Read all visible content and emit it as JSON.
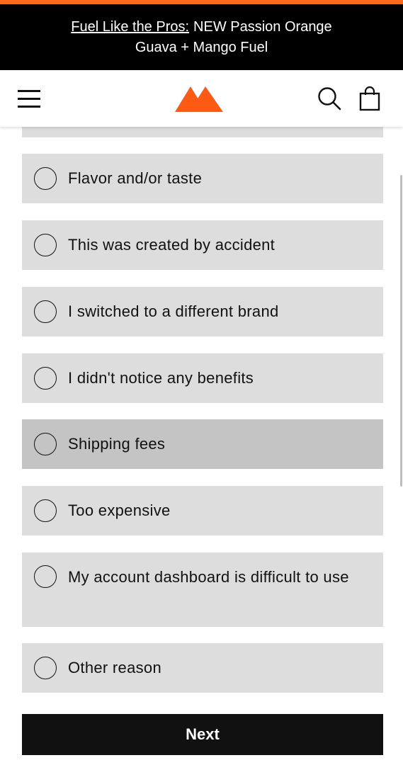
{
  "colors": {
    "accent": "#ff6b1a",
    "option_bg": "#dddddd",
    "option_hover_bg": "#c4c4c4",
    "button_bg": "#111111"
  },
  "announcement": {
    "link_text": "Fuel Like the Pros:",
    "line1_rest": "NEW Passion Orange",
    "line2": "Guava + Mango Fuel"
  },
  "header": {
    "menu_icon": "hamburger-icon",
    "logo_icon": "brand-m-logo",
    "search_icon": "search-icon",
    "cart_icon": "shopping-bag-icon"
  },
  "survey": {
    "options": [
      {
        "label": "Flavor and/or taste"
      },
      {
        "label": "This was created by accident"
      },
      {
        "label": "I switched to a different brand"
      },
      {
        "label": "I didn't notice any benefits"
      },
      {
        "label": "Shipping fees"
      },
      {
        "label": "Too expensive"
      },
      {
        "label": "My account dashboard is difficult to use"
      },
      {
        "label": "Other reason"
      }
    ],
    "next_label": "Next"
  }
}
